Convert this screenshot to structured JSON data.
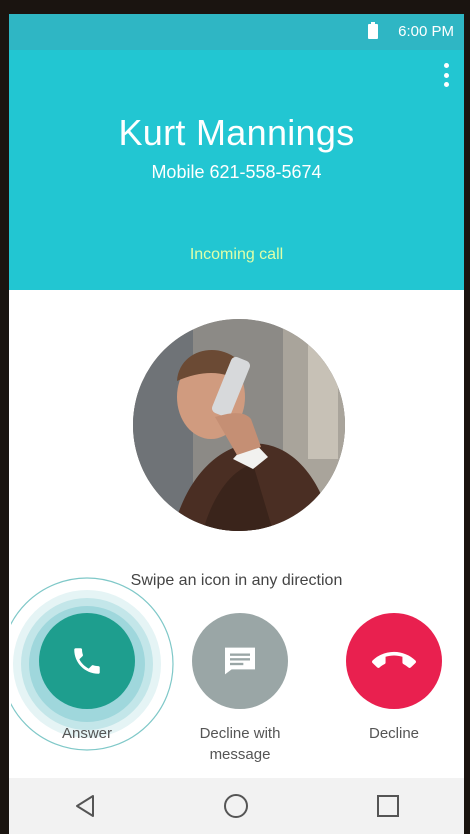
{
  "status_bar": {
    "time": "6:00 PM",
    "battery_icon": "battery-full-icon"
  },
  "header": {
    "menu_icon": "more-vert-icon",
    "caller_name": "Kurt Mannings",
    "caller_number": "Mobile 621-558-5674",
    "call_status": "Incoming call"
  },
  "swipe_hint": "Swipe an icon in any direction",
  "actions": {
    "answer": {
      "label": "Answer",
      "icon": "phone-icon",
      "color": "#1e9e8e"
    },
    "decline_with_message": {
      "label_line1": "Decline with",
      "label_line2": "message",
      "icon": "message-icon",
      "color": "#9aa6a6"
    },
    "decline": {
      "label": "Decline",
      "icon": "hang-up-icon",
      "color": "#e9204f"
    }
  },
  "nav_bar": {
    "back_icon": "back-icon",
    "home_icon": "home-icon",
    "recents_icon": "recents-icon"
  },
  "colors": {
    "header": "#22c6d2",
    "status_bar": "#2fb6c4",
    "call_status": "#dfffa8"
  }
}
